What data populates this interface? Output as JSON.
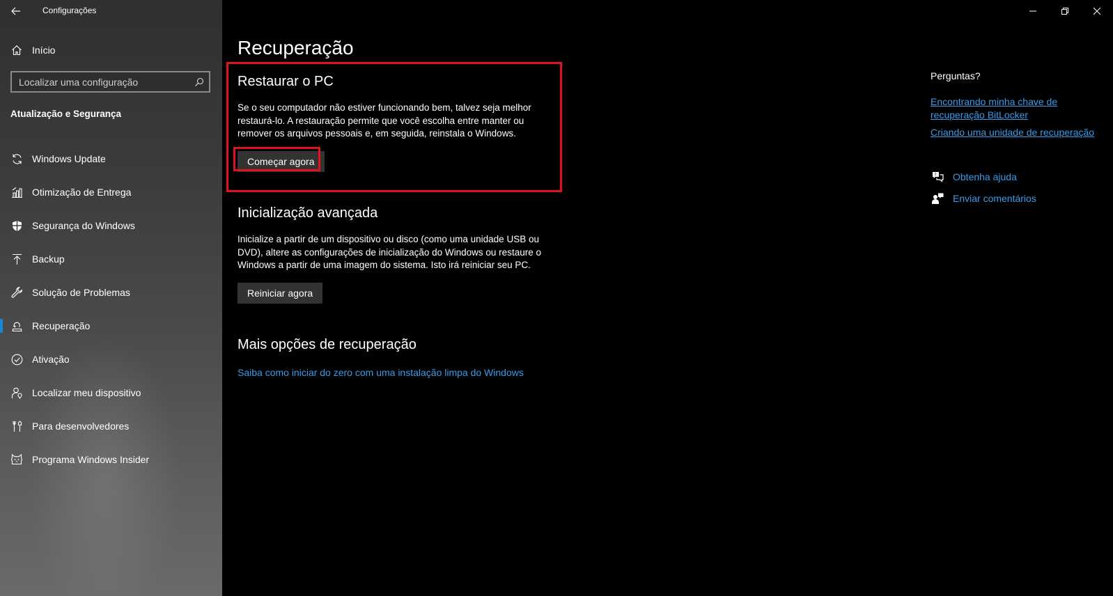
{
  "window": {
    "title": "Configurações"
  },
  "sidebar": {
    "home_label": "Início",
    "search": {
      "placeholder": "Localizar uma configuração"
    },
    "section_title": "Atualização e Segurança",
    "items": [
      {
        "label": "Windows Update",
        "icon": "refresh-icon"
      },
      {
        "label": "Otimização de Entrega",
        "icon": "delivery-optimization-icon"
      },
      {
        "label": "Segurança do Windows",
        "icon": "shield-icon"
      },
      {
        "label": "Backup",
        "icon": "backup-upload-icon"
      },
      {
        "label": "Solução de Problemas",
        "icon": "wrench-icon"
      },
      {
        "label": "Recuperação",
        "icon": "recovery-icon",
        "selected": true
      },
      {
        "label": "Ativação",
        "icon": "checkmark-circle-icon"
      },
      {
        "label": "Localizar meu dispositivo",
        "icon": "person-location-icon"
      },
      {
        "label": "Para desenvolvedores",
        "icon": "developer-tools-icon"
      },
      {
        "label": "Programa Windows Insider",
        "icon": "insider-cat-icon"
      }
    ]
  },
  "main": {
    "page_title": "Recuperação",
    "reset": {
      "heading": "Restaurar o PC",
      "description": "Se o seu computador não estiver funcionando bem, talvez seja melhor restaurá-lo. A restauração permite que você escolha entre manter ou remover os arquivos pessoais e, em seguida, reinstala o Windows.",
      "button_label": "Começar agora"
    },
    "advanced": {
      "heading": "Inicialização avançada",
      "description": "Inicialize a partir de um dispositivo ou disco (como uma unidade USB ou DVD), altere as configurações de inicialização do Windows ou restaure o Windows a partir de uma imagem do sistema. Isto irá reiniciar seu PC.",
      "button_label": "Reiniciar agora"
    },
    "more": {
      "heading": "Mais opções de recuperação",
      "link_label": "Saiba como iniciar do zero com uma instalação limpa do Windows"
    }
  },
  "right_panel": {
    "title": "Perguntas?",
    "links": [
      "Encontrando minha chave de recuperação BitLocker",
      "Criando uma unidade de recuperação"
    ],
    "help": {
      "label": "Obtenha ajuda",
      "icon": "get-help-icon"
    },
    "feedback": {
      "label": "Enviar comentários",
      "icon": "feedback-icon"
    }
  },
  "colors": {
    "accent": "#1a86d9",
    "link": "#3a9bea",
    "highlight": "#e0121b"
  }
}
